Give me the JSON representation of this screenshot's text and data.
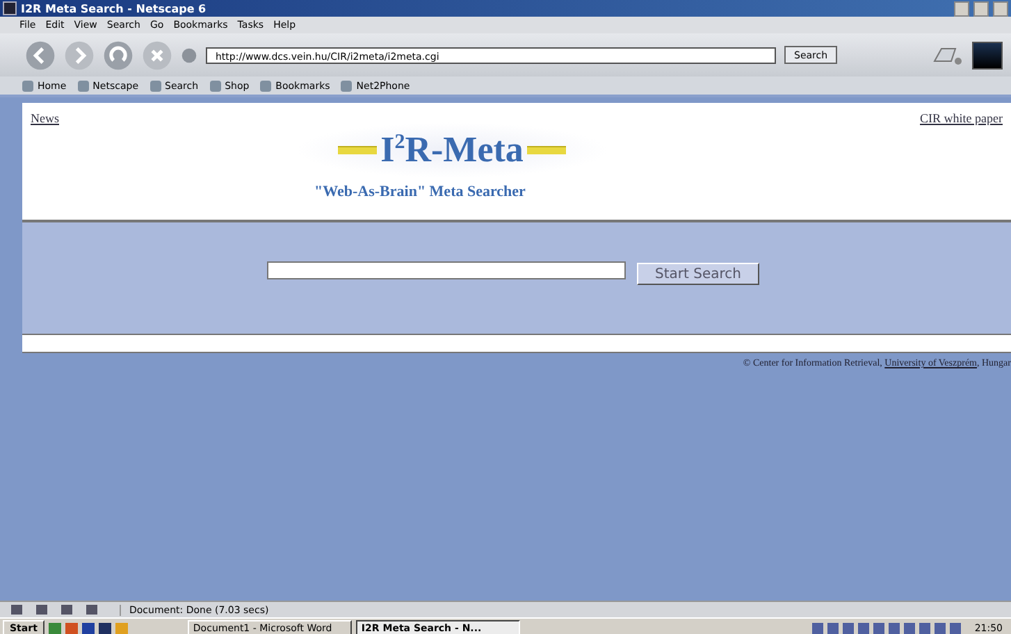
{
  "window": {
    "title": "I2R Meta Search - Netscape 6"
  },
  "menu": [
    "File",
    "Edit",
    "View",
    "Search",
    "Go",
    "Bookmarks",
    "Tasks",
    "Help"
  ],
  "navigation": {
    "url": "http://www.dcs.vein.hu/CIR/i2meta/i2meta.cgi",
    "search_button": "Search"
  },
  "personal_toolbar": [
    {
      "label": "Home"
    },
    {
      "label": "Netscape"
    },
    {
      "label": "Search"
    },
    {
      "label": "Shop"
    },
    {
      "label": "Bookmarks"
    },
    {
      "label": "Net2Phone"
    }
  ],
  "page": {
    "left_link": "News",
    "right_link": "CIR white paper",
    "logo": "I$^{2}$R-Meta",
    "tagline": "\"Web-As-Brain\" Meta Searcher",
    "search_button": "Start Search",
    "footer": {
      "text": "© Center for Information Retrieval, ",
      "link": "University of Veszprém",
      "rest": ", Hungar"
    }
  },
  "status_bar": {
    "text": "Document: Done (7.03 secs)"
  },
  "taskbar": {
    "start": "Start",
    "tasks": [
      {
        "label": "Document1 - Microsoft Word",
        "selected": false
      },
      {
        "label": "I2R Meta Search - N...",
        "selected": true
      }
    ],
    "clock": "21:50"
  }
}
